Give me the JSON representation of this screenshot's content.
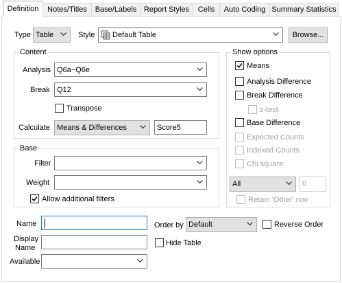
{
  "tabs": [
    {
      "label": "Definition",
      "active": true
    },
    {
      "label": "Notes/Titles",
      "active": false
    },
    {
      "label": "Base/Labels",
      "active": false
    },
    {
      "label": "Report Styles",
      "active": false
    },
    {
      "label": "Cells",
      "active": false
    },
    {
      "label": "Auto Coding",
      "active": false
    },
    {
      "label": "Summary Statistics",
      "active": false
    }
  ],
  "type": {
    "label": "Type",
    "value": "Table"
  },
  "style": {
    "label": "Style",
    "value": "Default Table",
    "icon": "table-style-icon"
  },
  "browse_label": "Browse...",
  "content": {
    "title": "Content",
    "analysis_label": "Analysis",
    "analysis_value": "Q6a~Q6e",
    "break_label": "Break",
    "break_value": "Q12",
    "transpose_label": "Transpose",
    "transpose_checked": false,
    "calculate_label": "Calculate",
    "calculate_value": "Means & Differences",
    "score_value": "Score5"
  },
  "show_options": {
    "title": "Show options",
    "items": [
      {
        "label": "Means",
        "checked": true,
        "enabled": true
      },
      {
        "label": "Analysis Difference",
        "checked": false,
        "enabled": true
      },
      {
        "label": "Break Difference",
        "checked": false,
        "enabled": true
      },
      {
        "label": "z-test",
        "checked": false,
        "enabled": false
      },
      {
        "label": "Base Difference",
        "checked": false,
        "enabled": true
      },
      {
        "label": "Expected Counts",
        "checked": false,
        "enabled": false
      },
      {
        "label": "Indexed Counts",
        "checked": false,
        "enabled": false
      },
      {
        "label": "Chi square",
        "checked": false,
        "enabled": false
      }
    ],
    "all_value": "All",
    "count_value": "0",
    "retain_label": "Retain 'Other' row"
  },
  "base": {
    "title": "Base",
    "filter_label": "Filter",
    "filter_value": "",
    "weight_label": "Weight",
    "weight_value": "",
    "allow_filters_label": "Allow additional filters",
    "allow_filters_checked": true
  },
  "bottom": {
    "name_label": "Name",
    "name_value": "",
    "display_name_label_line1": "Display",
    "display_name_label_line2": "Name",
    "display_name_value": "",
    "available_label": "Available",
    "available_value": "",
    "order_by_label": "Order by",
    "order_by_value": "Default",
    "reverse_order_label": "Reverse Order",
    "hide_table_label": "Hide Table"
  },
  "colors": {
    "focus_border": "#0078d7",
    "disabled_text": "#a0a0a0",
    "button_face": "#e1e1e1"
  }
}
